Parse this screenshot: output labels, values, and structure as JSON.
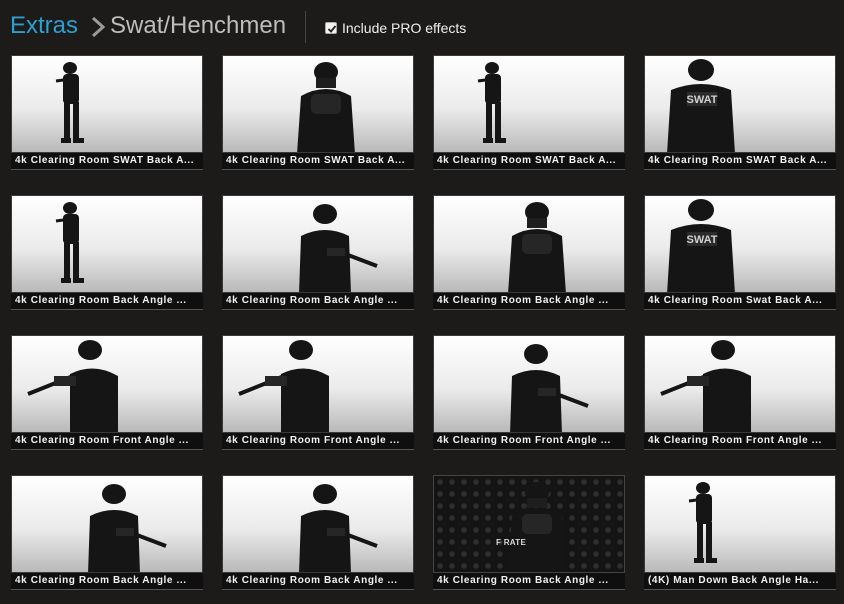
{
  "header": {
    "breadcrumb_root": "Extras",
    "breadcrumb_current": "Swat/Henchmen",
    "pro_label": "Include PRO effects",
    "pro_checked": true
  },
  "tiles": [
    {
      "title": "4k Clearing Room SWAT Back A...",
      "style": "light",
      "pose": "small"
    },
    {
      "title": "4k Clearing Room SWAT Back A...",
      "style": "light",
      "pose": "closeup"
    },
    {
      "title": "4k Clearing Room SWAT Back A...",
      "style": "light",
      "pose": "small"
    },
    {
      "title": "4k Clearing Room SWAT Back A...",
      "style": "light",
      "pose": "back",
      "back_text": "SWAT"
    },
    {
      "title": "4k Clearing Room Back Angle ...",
      "style": "light",
      "pose": "small"
    },
    {
      "title": "4k Clearing Room Back Angle ...",
      "style": "light",
      "pose": "rifle"
    },
    {
      "title": "4k Clearing Room Back Angle ...",
      "style": "light",
      "pose": "closeup"
    },
    {
      "title": "4k Clearing Room Swat Back A...",
      "style": "light",
      "pose": "back",
      "back_text": "SWAT"
    },
    {
      "title": "4k Clearing Room Front Angle ...",
      "style": "light",
      "pose": "aim-left"
    },
    {
      "title": "4k Clearing Room Front Angle ...",
      "style": "light",
      "pose": "aim-left"
    },
    {
      "title": "4k Clearing Room Front Angle ...",
      "style": "light",
      "pose": "rifle"
    },
    {
      "title": "4k Clearing Room Front Angle ...",
      "style": "light",
      "pose": "aim-left"
    },
    {
      "title": "4k Clearing Room Back Angle ...",
      "style": "light",
      "pose": "rifle"
    },
    {
      "title": "4k Clearing Room Back Angle ...",
      "style": "light",
      "pose": "rifle"
    },
    {
      "title": "4k Clearing Room Back Angle ...",
      "style": "dark",
      "pose": "closeup",
      "overlay_text": "F          RATE"
    },
    {
      "title": "(4K) Man Down Back Angle Ha...",
      "style": "light",
      "pose": "small"
    }
  ]
}
